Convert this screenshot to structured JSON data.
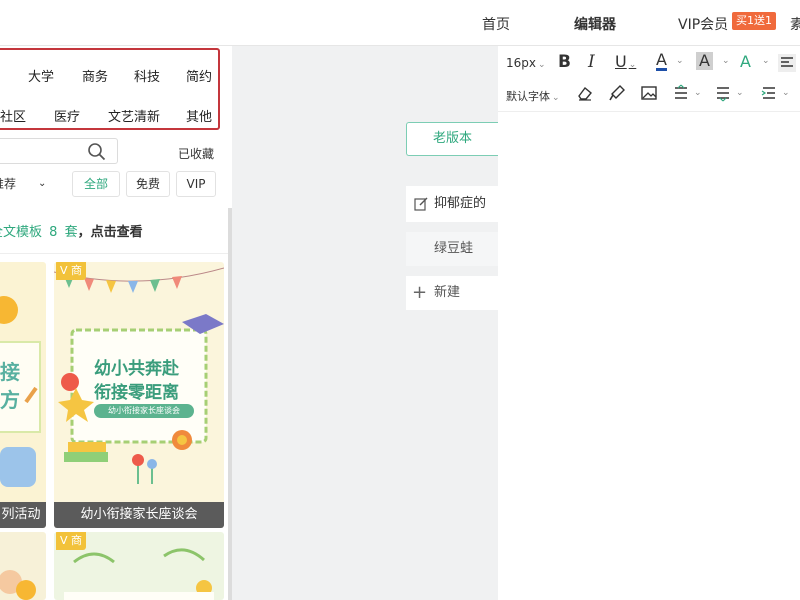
{
  "topnav": {
    "home": "首页",
    "editor": "编辑器",
    "vip": "VIP会员",
    "vip_badge": "买1送1",
    "truncated": "素"
  },
  "categories": {
    "row1": [
      "大学",
      "商务",
      "科技",
      "简约"
    ],
    "row2": [
      "社区",
      "医疗",
      "文艺清新",
      "其他"
    ]
  },
  "search": {
    "value": ""
  },
  "favorites_label": "已收藏",
  "filter": {
    "sort_selected": "推荐",
    "options": [
      "全部",
      "免费",
      "VIP"
    ]
  },
  "notice": {
    "prefix": "全文模板",
    "count": "8",
    "unit": "套",
    "suffix": "，点击查看"
  },
  "cards": [
    {
      "caption": "列活动",
      "art_line1": "接",
      "art_line2": "方",
      "vip": ""
    },
    {
      "caption": "幼小衔接家长座谈会",
      "art_line1": "幼小共奔赴",
      "art_line2": "衔接零距离",
      "art_sub": "幼小衔接家长座谈会",
      "vip": "商"
    },
    {
      "caption": "",
      "vip": ""
    },
    {
      "caption": "",
      "vip": "商"
    }
  ],
  "middle": {
    "old_version": "老版本",
    "docs": [
      "抑郁症的",
      "绿豆蛙"
    ],
    "new_label": "新建"
  },
  "toolbar": {
    "font_size": "16px",
    "font_family": "默认字体"
  },
  "colors": {
    "accent": "#2fa87e",
    "highlight_border": "#c4363c",
    "vip_badge": "#f06a3c"
  }
}
